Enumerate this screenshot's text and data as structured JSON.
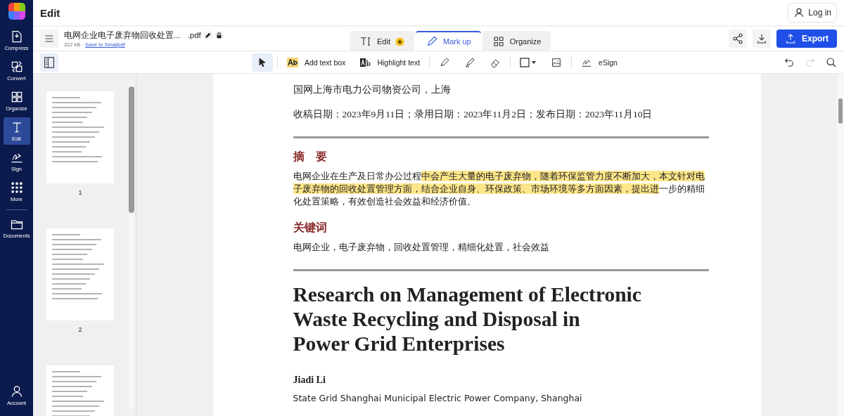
{
  "header": {
    "title": "Edit",
    "login": "Log in"
  },
  "sidebar": {
    "items": [
      {
        "label": "Compress",
        "selected": false
      },
      {
        "label": "Convert",
        "selected": false
      },
      {
        "label": "Organize",
        "selected": false
      },
      {
        "label": "Edit",
        "selected": true
      },
      {
        "label": "Sign",
        "selected": false
      },
      {
        "label": "More",
        "selected": false
      },
      {
        "label": "Documents",
        "selected": false
      }
    ],
    "account": "Account"
  },
  "file": {
    "name": "电网企业电子废弃物回收处置...",
    "ext": ".pdf",
    "size": "322 kB",
    "separator": "·",
    "save_link": "Save to Smallpdf"
  },
  "mode_tabs": [
    {
      "label": "Edit",
      "premium": true,
      "selected": false
    },
    {
      "label": "Mark up",
      "premium": false,
      "selected": true
    },
    {
      "label": "Organize",
      "premium": false,
      "selected": false
    }
  ],
  "export_button": "Export",
  "tools": [
    {
      "kind": "select",
      "selected": true
    },
    {
      "kind": "text-box",
      "label": "Add text box",
      "selected": false
    },
    {
      "kind": "highlight",
      "label": "Highlight text",
      "selected": false
    },
    {
      "kind": "pen",
      "selected": false
    },
    {
      "kind": "marker",
      "selected": false
    },
    {
      "kind": "eraser",
      "selected": false
    },
    {
      "kind": "shape",
      "selected": false
    },
    {
      "kind": "image",
      "selected": false
    },
    {
      "kind": "esign",
      "label": "eSign",
      "selected": false
    }
  ],
  "thumbnails": {
    "labels": [
      "1",
      "2"
    ]
  },
  "document": {
    "affiliation_cn": "国网上海市电力公司物资公司，上海",
    "dates": "收稿日期：2023年9月11日；录用日期：2023年11月2日；发布日期：2023年11月10日",
    "abstract_heading": "摘　要",
    "abstract": [
      {
        "text": "电网企业在生产及日常办公过程",
        "highlighted": false
      },
      {
        "text": "中会产生大量的电子废弃物，随着环保监管力度不断加大，本文针对电子废弃物的回收处置管理方面，结合企业自身、环保政策、市场环境等多方面因素，提出进",
        "highlighted": true
      },
      {
        "text": "一步的精细化处置策略，有效创造社会效益和经济价值。",
        "highlighted": false
      }
    ],
    "keywords_heading": "关键词",
    "keywords": "电网企业，电子废弃物，回收处置管理，精细化处置，社会效益",
    "title_lines": [
      "Research on Management of Electronic",
      "Waste Recycling and Disposal in",
      "Power Grid Enterprises"
    ],
    "author": "Jiadi Li",
    "affiliation_en": "State Grid Shanghai Municipal Electric Power Company, Shanghai"
  }
}
